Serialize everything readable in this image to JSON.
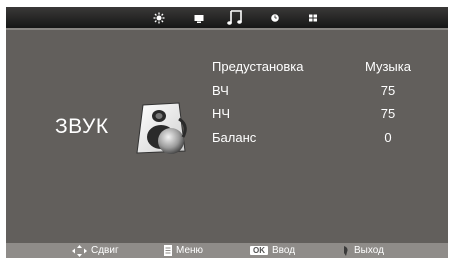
{
  "top_menu": {
    "icons": [
      "picture-icon",
      "screen-icon",
      "music-note-icon",
      "clock-icon",
      "grid-icon"
    ],
    "active": "music-note-icon"
  },
  "section": {
    "title": "ЗВУК"
  },
  "settings": {
    "preset": {
      "label": "Предустановка",
      "value": "Музыка"
    },
    "treble": {
      "label": "ВЧ",
      "value": "75"
    },
    "bass": {
      "label": "НЧ",
      "value": "75"
    },
    "balance": {
      "label": "Баланс",
      "value": "0"
    }
  },
  "hints": {
    "move": "Сдвиг",
    "menu": "Меню",
    "ok_key": "OK",
    "enter": "Ввод",
    "exit": "Выход"
  },
  "colors": {
    "background": "#625f5c",
    "bottom_bar": "#8f8c89",
    "top_bar": "#161616"
  }
}
